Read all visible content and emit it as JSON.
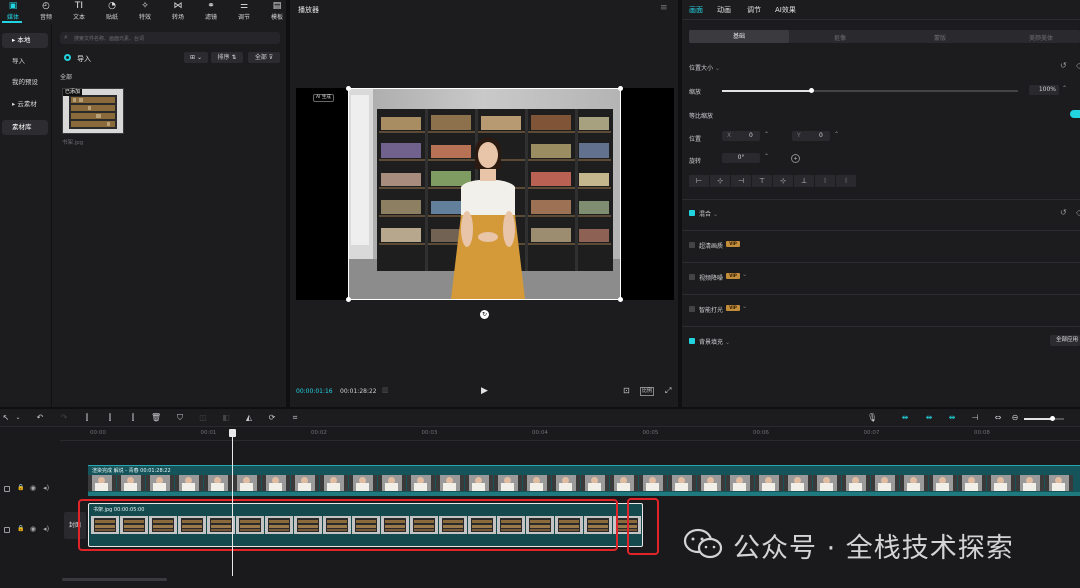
{
  "toolbar": {
    "items": [
      {
        "label": "媒体",
        "icon": "media-icon",
        "glyph": "▣"
      },
      {
        "label": "音频",
        "icon": "audio-icon",
        "glyph": "◴"
      },
      {
        "label": "文本",
        "icon": "text-icon",
        "glyph": "TI"
      },
      {
        "label": "贴纸",
        "icon": "sticker-icon",
        "glyph": "◔"
      },
      {
        "label": "特效",
        "icon": "effects-icon",
        "glyph": "✧"
      },
      {
        "label": "转场",
        "icon": "transition-icon",
        "glyph": "⋈"
      },
      {
        "label": "滤镜",
        "icon": "filter-icon",
        "glyph": "⚭"
      },
      {
        "label": "调节",
        "icon": "adjust-icon",
        "glyph": "⚌"
      },
      {
        "label": "模板",
        "icon": "template-icon",
        "glyph": "▤"
      }
    ],
    "active_index": 0
  },
  "sidebar": {
    "items": [
      {
        "label": "▸ 本地",
        "active": true
      },
      {
        "label": "导入",
        "active": false
      },
      {
        "label": "我的预设",
        "active": false
      },
      {
        "label": "▸ 云素材",
        "active": false
      },
      {
        "label": "素材库",
        "active": false
      }
    ]
  },
  "media": {
    "search_placeholder": "搜索文件名称、画面元素、台词",
    "import_label": "导入",
    "sort_label": "排序",
    "filter_label": "全部",
    "section_label": "全部",
    "added_badge": "已添加",
    "file_name": "书架.jpg"
  },
  "player": {
    "title": "播放器",
    "current_time": "00:00:01:16",
    "total_time": "00:01:28:22",
    "ratio_label": "比例",
    "overlay_tag": "AI 生成"
  },
  "properties": {
    "tabs": [
      "画面",
      "动画",
      "调节",
      "AI效果"
    ],
    "active_tab": 0,
    "subtabs": [
      "基础",
      "抠像",
      "蒙版",
      "美颜美体"
    ],
    "active_subtab": 0,
    "position_size_label": "位置大小",
    "scale_label": "缩放",
    "scale_value": "100%",
    "scale_level": 0.3,
    "uniform_scale_label": "等比缩放",
    "position_label": "位置",
    "x_label": "X",
    "x_value": "0",
    "y_label": "Y",
    "y_value": "0",
    "rotation_label": "旋转",
    "rotation_value": "0°",
    "align_icons": [
      "align-left-icon",
      "align-center-h-icon",
      "align-right-icon",
      "align-top-icon",
      "align-center-v-icon",
      "align-bottom-icon",
      "distribute-h-icon",
      "distribute-v-icon"
    ],
    "blend_label": "混合",
    "ultra_hd_label": "超清画质",
    "denoise_label": "视频降噪",
    "smart_light_label": "智能打光",
    "vip_label": "VIP",
    "bg_fill_label": "背景填充",
    "apply_all_label": "全部应用"
  },
  "timeline": {
    "ruler": [
      "00:00",
      "00:01",
      "00:02",
      "00:03",
      "00:04",
      "00:05",
      "00:06",
      "00:07",
      "00:08"
    ],
    "playhead_fraction": 0.1447,
    "main_clip_label": "渲染完成  解说 - 青春  00:01:28:22",
    "image_clip_label": "书架.jpg  00:00:05:00",
    "cover_label": "封面",
    "zoom_level": 0.7
  },
  "watermark": {
    "text": "公众号 · 全栈技术探索"
  },
  "colors": {
    "accent": "#22d3e0",
    "clip_teal": "#1c6e70",
    "highlight_red": "#e0242a"
  }
}
